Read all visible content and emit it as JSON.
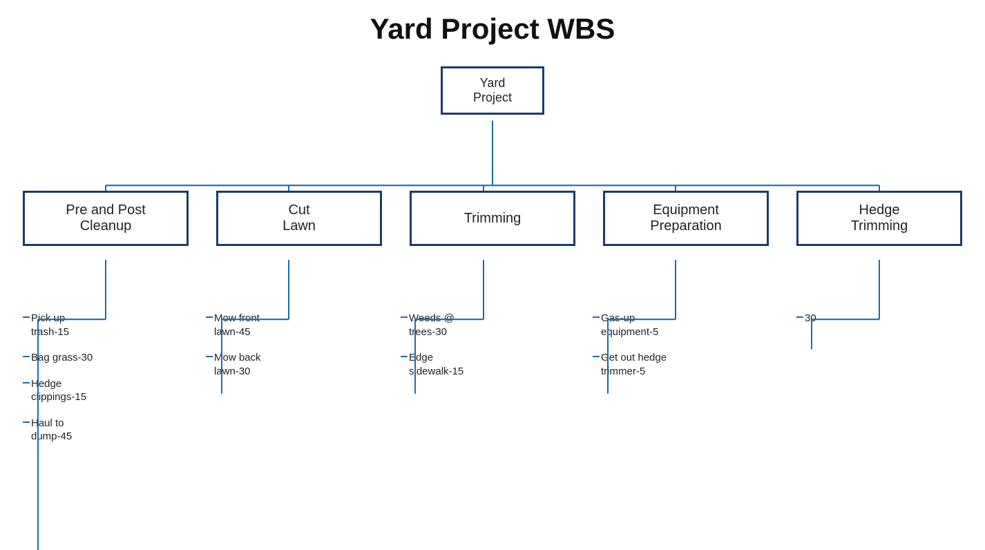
{
  "title": "Yard Project WBS",
  "root": {
    "label": "Yard\nProject"
  },
  "level2": [
    {
      "label": "Pre and Post\nCleanup",
      "children": [
        "Pick up trash-15",
        "Bag grass-30",
        "Hedge clippings-15",
        "Haul to dump-45"
      ]
    },
    {
      "label": "Cut\nLawn",
      "children": [
        "Mow front lawn-45",
        "Mow back lawn-30"
      ]
    },
    {
      "label": "Trimming",
      "children": [
        "Weeds @ trees-30",
        "Edge sidewalk-15"
      ]
    },
    {
      "label": "Equipment\nPreparation",
      "children": [
        "Gas-up equipment-5",
        "Get out hedge trimmer-5"
      ]
    },
    {
      "label": "Hedge\nTrimming",
      "children": [
        "30"
      ]
    }
  ]
}
